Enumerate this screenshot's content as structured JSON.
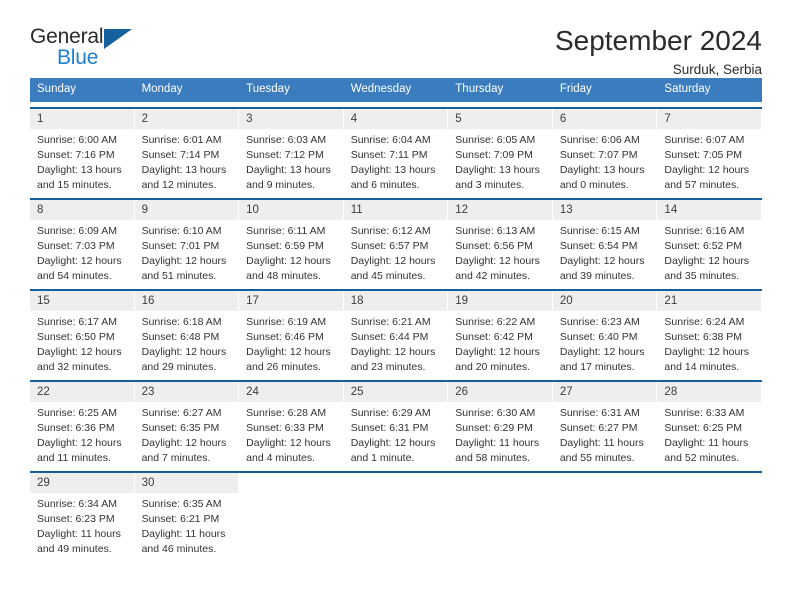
{
  "brand": {
    "word_one": "General",
    "word_two": "Blue",
    "logo_icon": "triangle-logo-icon"
  },
  "header": {
    "title": "September 2024",
    "subtitle": "Surduk, Serbia"
  },
  "colors": {
    "header_blue": "#3a7cbe",
    "rule_blue": "#14609c",
    "brand_blue": "#1f7fd1",
    "daynum_gray": "#eeeeee"
  },
  "weekdays": [
    "Sunday",
    "Monday",
    "Tuesday",
    "Wednesday",
    "Thursday",
    "Friday",
    "Saturday"
  ],
  "weeks": [
    [
      {
        "num": "1",
        "sunrise": "Sunrise: 6:00 AM",
        "sunset": "Sunset: 7:16 PM",
        "daylight": "Daylight: 13 hours and 15 minutes."
      },
      {
        "num": "2",
        "sunrise": "Sunrise: 6:01 AM",
        "sunset": "Sunset: 7:14 PM",
        "daylight": "Daylight: 13 hours and 12 minutes."
      },
      {
        "num": "3",
        "sunrise": "Sunrise: 6:03 AM",
        "sunset": "Sunset: 7:12 PM",
        "daylight": "Daylight: 13 hours and 9 minutes."
      },
      {
        "num": "4",
        "sunrise": "Sunrise: 6:04 AM",
        "sunset": "Sunset: 7:11 PM",
        "daylight": "Daylight: 13 hours and 6 minutes."
      },
      {
        "num": "5",
        "sunrise": "Sunrise: 6:05 AM",
        "sunset": "Sunset: 7:09 PM",
        "daylight": "Daylight: 13 hours and 3 minutes."
      },
      {
        "num": "6",
        "sunrise": "Sunrise: 6:06 AM",
        "sunset": "Sunset: 7:07 PM",
        "daylight": "Daylight: 13 hours and 0 minutes."
      },
      {
        "num": "7",
        "sunrise": "Sunrise: 6:07 AM",
        "sunset": "Sunset: 7:05 PM",
        "daylight": "Daylight: 12 hours and 57 minutes."
      }
    ],
    [
      {
        "num": "8",
        "sunrise": "Sunrise: 6:09 AM",
        "sunset": "Sunset: 7:03 PM",
        "daylight": "Daylight: 12 hours and 54 minutes."
      },
      {
        "num": "9",
        "sunrise": "Sunrise: 6:10 AM",
        "sunset": "Sunset: 7:01 PM",
        "daylight": "Daylight: 12 hours and 51 minutes."
      },
      {
        "num": "10",
        "sunrise": "Sunrise: 6:11 AM",
        "sunset": "Sunset: 6:59 PM",
        "daylight": "Daylight: 12 hours and 48 minutes."
      },
      {
        "num": "11",
        "sunrise": "Sunrise: 6:12 AM",
        "sunset": "Sunset: 6:57 PM",
        "daylight": "Daylight: 12 hours and 45 minutes."
      },
      {
        "num": "12",
        "sunrise": "Sunrise: 6:13 AM",
        "sunset": "Sunset: 6:56 PM",
        "daylight": "Daylight: 12 hours and 42 minutes."
      },
      {
        "num": "13",
        "sunrise": "Sunrise: 6:15 AM",
        "sunset": "Sunset: 6:54 PM",
        "daylight": "Daylight: 12 hours and 39 minutes."
      },
      {
        "num": "14",
        "sunrise": "Sunrise: 6:16 AM",
        "sunset": "Sunset: 6:52 PM",
        "daylight": "Daylight: 12 hours and 35 minutes."
      }
    ],
    [
      {
        "num": "15",
        "sunrise": "Sunrise: 6:17 AM",
        "sunset": "Sunset: 6:50 PM",
        "daylight": "Daylight: 12 hours and 32 minutes."
      },
      {
        "num": "16",
        "sunrise": "Sunrise: 6:18 AM",
        "sunset": "Sunset: 6:48 PM",
        "daylight": "Daylight: 12 hours and 29 minutes."
      },
      {
        "num": "17",
        "sunrise": "Sunrise: 6:19 AM",
        "sunset": "Sunset: 6:46 PM",
        "daylight": "Daylight: 12 hours and 26 minutes."
      },
      {
        "num": "18",
        "sunrise": "Sunrise: 6:21 AM",
        "sunset": "Sunset: 6:44 PM",
        "daylight": "Daylight: 12 hours and 23 minutes."
      },
      {
        "num": "19",
        "sunrise": "Sunrise: 6:22 AM",
        "sunset": "Sunset: 6:42 PM",
        "daylight": "Daylight: 12 hours and 20 minutes."
      },
      {
        "num": "20",
        "sunrise": "Sunrise: 6:23 AM",
        "sunset": "Sunset: 6:40 PM",
        "daylight": "Daylight: 12 hours and 17 minutes."
      },
      {
        "num": "21",
        "sunrise": "Sunrise: 6:24 AM",
        "sunset": "Sunset: 6:38 PM",
        "daylight": "Daylight: 12 hours and 14 minutes."
      }
    ],
    [
      {
        "num": "22",
        "sunrise": "Sunrise: 6:25 AM",
        "sunset": "Sunset: 6:36 PM",
        "daylight": "Daylight: 12 hours and 11 minutes."
      },
      {
        "num": "23",
        "sunrise": "Sunrise: 6:27 AM",
        "sunset": "Sunset: 6:35 PM",
        "daylight": "Daylight: 12 hours and 7 minutes."
      },
      {
        "num": "24",
        "sunrise": "Sunrise: 6:28 AM",
        "sunset": "Sunset: 6:33 PM",
        "daylight": "Daylight: 12 hours and 4 minutes."
      },
      {
        "num": "25",
        "sunrise": "Sunrise: 6:29 AM",
        "sunset": "Sunset: 6:31 PM",
        "daylight": "Daylight: 12 hours and 1 minute."
      },
      {
        "num": "26",
        "sunrise": "Sunrise: 6:30 AM",
        "sunset": "Sunset: 6:29 PM",
        "daylight": "Daylight: 11 hours and 58 minutes."
      },
      {
        "num": "27",
        "sunrise": "Sunrise: 6:31 AM",
        "sunset": "Sunset: 6:27 PM",
        "daylight": "Daylight: 11 hours and 55 minutes."
      },
      {
        "num": "28",
        "sunrise": "Sunrise: 6:33 AM",
        "sunset": "Sunset: 6:25 PM",
        "daylight": "Daylight: 11 hours and 52 minutes."
      }
    ],
    [
      {
        "num": "29",
        "sunrise": "Sunrise: 6:34 AM",
        "sunset": "Sunset: 6:23 PM",
        "daylight": "Daylight: 11 hours and 49 minutes."
      },
      {
        "num": "30",
        "sunrise": "Sunrise: 6:35 AM",
        "sunset": "Sunset: 6:21 PM",
        "daylight": "Daylight: 11 hours and 46 minutes."
      },
      {
        "num": "",
        "sunrise": "",
        "sunset": "",
        "daylight": ""
      },
      {
        "num": "",
        "sunrise": "",
        "sunset": "",
        "daylight": ""
      },
      {
        "num": "",
        "sunrise": "",
        "sunset": "",
        "daylight": ""
      },
      {
        "num": "",
        "sunrise": "",
        "sunset": "",
        "daylight": ""
      },
      {
        "num": "",
        "sunrise": "",
        "sunset": "",
        "daylight": ""
      }
    ]
  ]
}
